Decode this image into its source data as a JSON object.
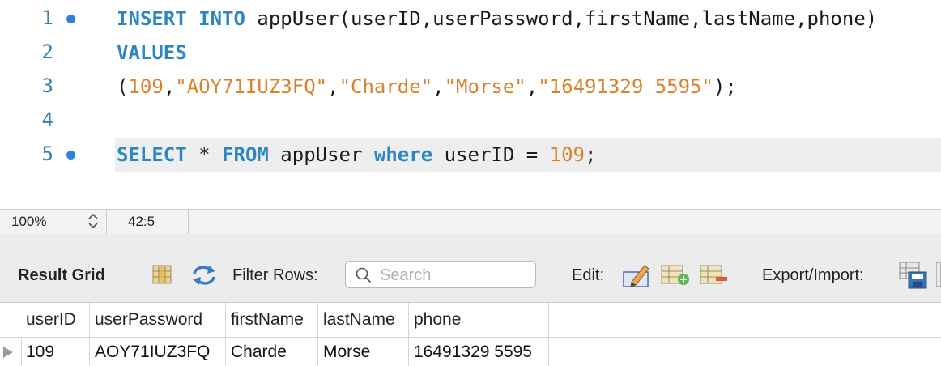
{
  "editor": {
    "lines": [
      {
        "num": "1",
        "has_dot": true,
        "tokens": [
          {
            "t": "INSERT",
            "c": "kw"
          },
          {
            "t": " ",
            "c": ""
          },
          {
            "t": "INTO",
            "c": "kw"
          },
          {
            "t": " appUser(userID,userPassword,firstName,lastName,phone)",
            "c": ""
          }
        ]
      },
      {
        "num": "2",
        "has_dot": false,
        "tokens": [
          {
            "t": "VALUES",
            "c": "kw"
          }
        ]
      },
      {
        "num": "3",
        "has_dot": false,
        "tokens": [
          {
            "t": "(",
            "c": ""
          },
          {
            "t": "109",
            "c": "num"
          },
          {
            "t": ",",
            "c": ""
          },
          {
            "t": "\"AOY71IUZ3FQ\"",
            "c": "str"
          },
          {
            "t": ",",
            "c": ""
          },
          {
            "t": "\"Charde\"",
            "c": "str"
          },
          {
            "t": ",",
            "c": ""
          },
          {
            "t": "\"Morse\"",
            "c": "str"
          },
          {
            "t": ",",
            "c": ""
          },
          {
            "t": "\"16491329 5595\"",
            "c": "str"
          },
          {
            "t": ");",
            "c": ""
          }
        ]
      },
      {
        "num": "4",
        "has_dot": false,
        "tokens": []
      },
      {
        "num": "5",
        "has_dot": true,
        "current": true,
        "tokens": [
          {
            "t": "SELECT",
            "c": "kw"
          },
          {
            "t": " ",
            "c": ""
          },
          {
            "t": "*",
            "c": "star"
          },
          {
            "t": " ",
            "c": ""
          },
          {
            "t": "FROM",
            "c": "kw"
          },
          {
            "t": " appUser ",
            "c": ""
          },
          {
            "t": "where",
            "c": "kw2"
          },
          {
            "t": " userID = ",
            "c": ""
          },
          {
            "t": "109",
            "c": "num"
          },
          {
            "t": ";",
            "c": ""
          }
        ]
      }
    ]
  },
  "status": {
    "zoom": "100%",
    "cursor_pos": "42:5"
  },
  "toolbar": {
    "title": "Result Grid",
    "filter_label": "Filter Rows:",
    "search_placeholder": "Search",
    "edit_label": "Edit:",
    "export_label": "Export/Import:"
  },
  "grid": {
    "columns": [
      "userID",
      "userPassword",
      "firstName",
      "lastName",
      "phone"
    ],
    "rows": [
      [
        "109",
        "AOY71IUZ3FQ",
        "Charde",
        "Morse",
        "16491329 5595"
      ]
    ]
  },
  "colors": {
    "keyword": "#2e86c1",
    "string": "#d9822b",
    "line_number": "#3b7fb0",
    "breakpoint_dot": "#2f80d9"
  }
}
